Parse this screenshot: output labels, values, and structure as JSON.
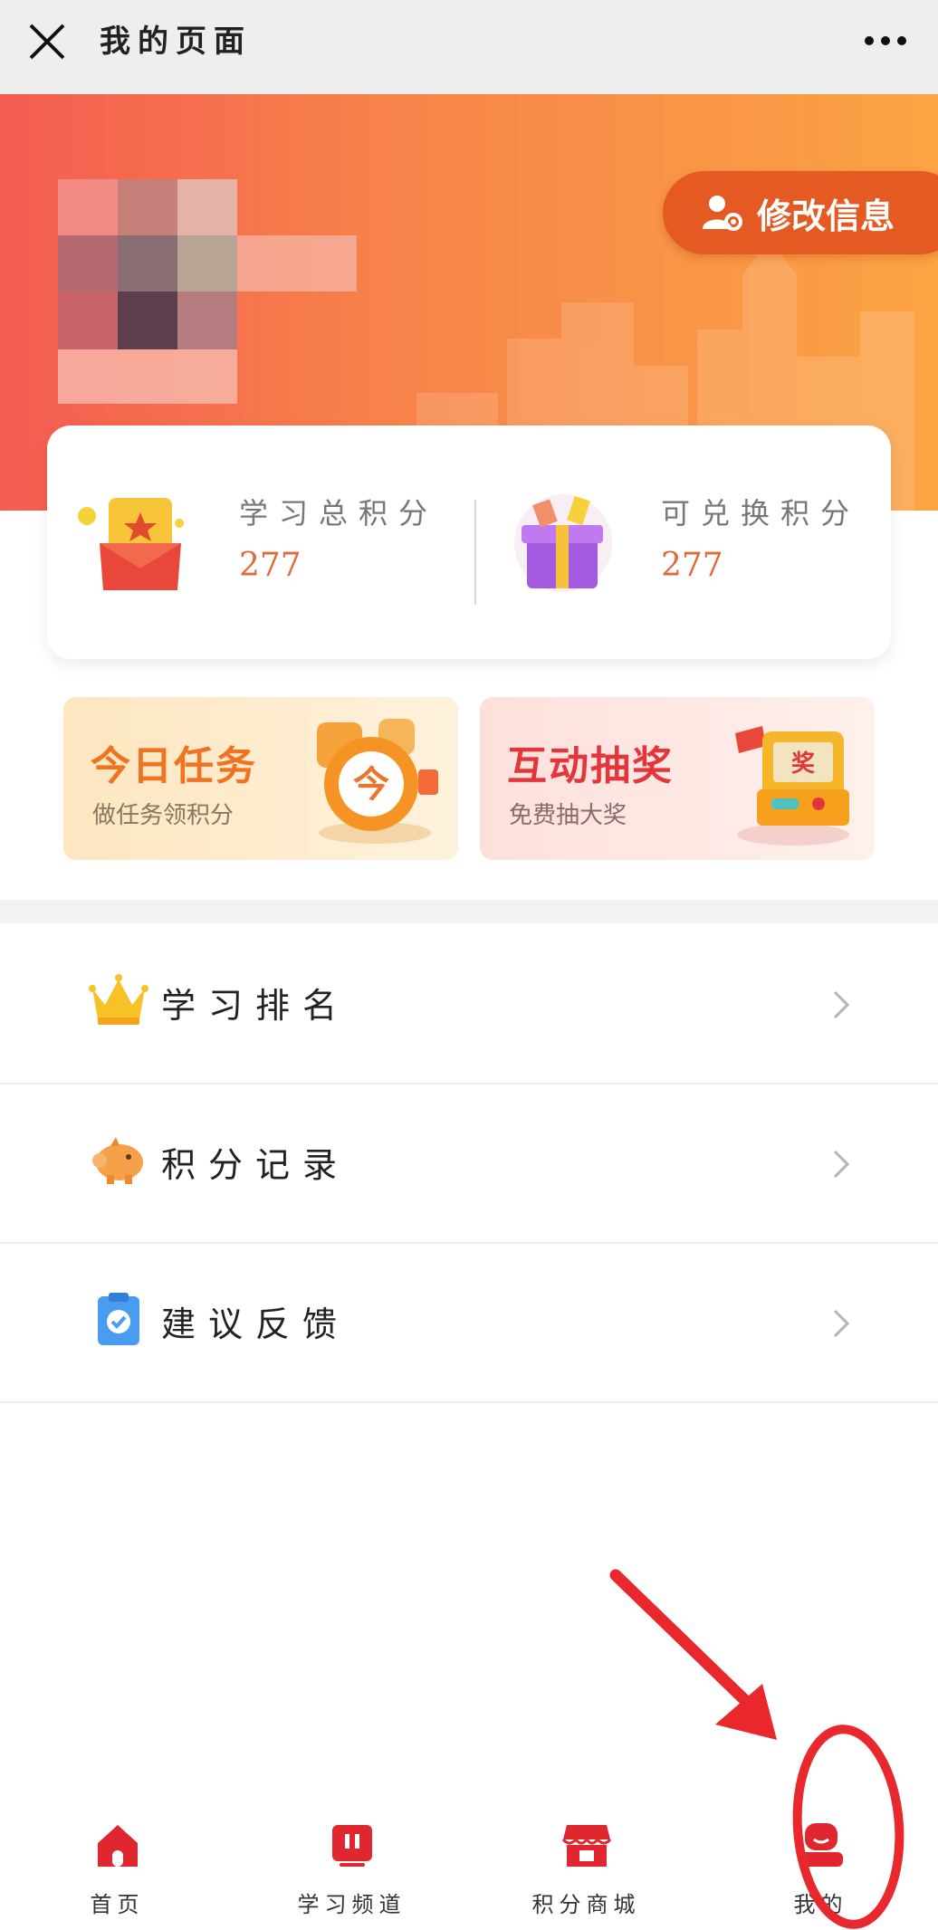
{
  "header": {
    "title": "我的页面"
  },
  "profile": {
    "edit_label": "修改信息"
  },
  "points": [
    {
      "label": "学习总积分",
      "value": "277"
    },
    {
      "label": "可兑换积分",
      "value": "277"
    }
  ],
  "promos": [
    {
      "title": "今日任务",
      "subtitle": "做任务领积分",
      "badge": "今"
    },
    {
      "title": "互动抽奖",
      "subtitle": "免费抽大奖",
      "badge": "奖"
    }
  ],
  "menu": [
    {
      "label": "学习排名"
    },
    {
      "label": "积分记录"
    },
    {
      "label": "建议反馈"
    }
  ],
  "tabs": [
    {
      "label": "首页"
    },
    {
      "label": "学习频道"
    },
    {
      "label": "积分商城"
    },
    {
      "label": "我的",
      "active": true
    }
  ],
  "colors": {
    "accent": "#e0262e",
    "hero_start": "#f45c52",
    "hero_end": "#fca444",
    "points_value": "#e06a3a",
    "annotation": "#e8282c"
  }
}
